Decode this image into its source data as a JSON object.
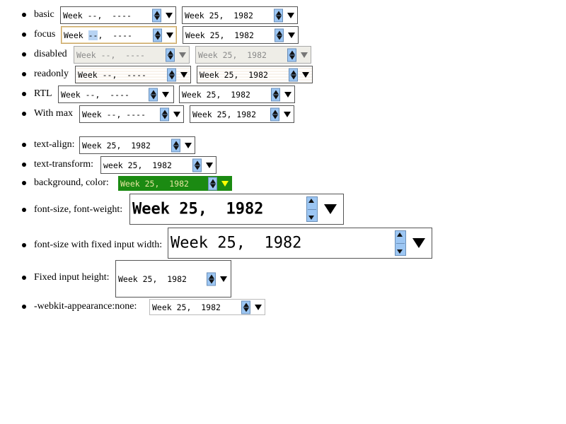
{
  "rows": [
    {
      "label": "basic",
      "empty": "Week --,  ----",
      "filled": "Week 25,  1982"
    },
    {
      "label": "focus",
      "empty_pre": "Week ",
      "empty_sel": "--",
      "empty_post": ",  ----",
      "filled": "Week 25,  1982"
    },
    {
      "label": "disabled",
      "empty": "Week --,  ----",
      "filled": "Week 25,  1982"
    },
    {
      "label": "readonly",
      "empty": "Week --,  ----",
      "filled": "Week 25,  1982"
    },
    {
      "label": "RTL",
      "empty": "Week --,  ----",
      "filled": "Week 25,  1982"
    },
    {
      "label": "With max",
      "empty": "Week --, ----",
      "filled": "Week 25, 1982"
    }
  ],
  "styled": [
    {
      "label": "text-align:",
      "value": "Week 25,  1982"
    },
    {
      "label": "text-transform:",
      "value": "week 25,  1982"
    },
    {
      "label": "background, color:",
      "value": "Week 25,  1982"
    },
    {
      "label": "font-size, font-weight:",
      "value": "Week 25,  1982"
    },
    {
      "label": "font-size with fixed input width:",
      "value": "Week 25,  1982"
    },
    {
      "label": "Fixed input height:",
      "value": "Week 25,  1982"
    },
    {
      "label": "-webkit-appearance:none:",
      "value": "Week 25,  1982"
    }
  ]
}
